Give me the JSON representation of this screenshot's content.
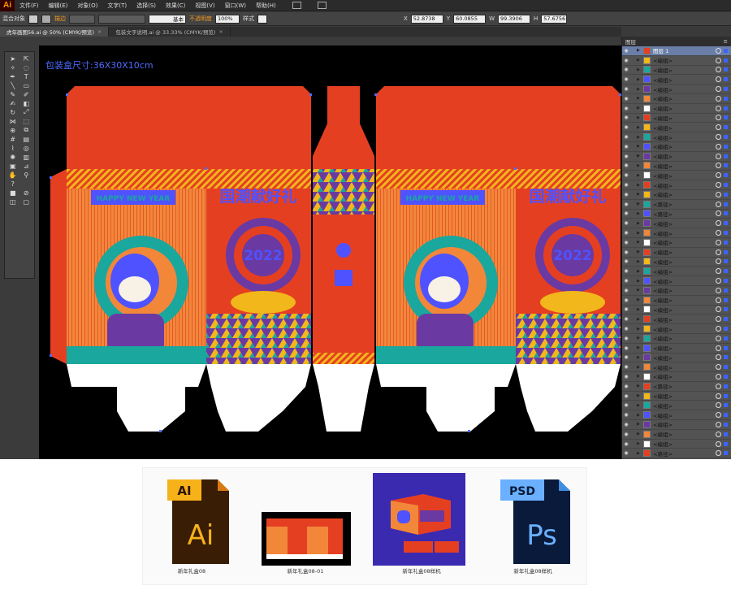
{
  "menubar": {
    "logo": "Ai",
    "items": [
      "文件(F)",
      "编辑(E)",
      "对象(O)",
      "文字(T)",
      "选择(S)",
      "效果(C)",
      "视图(V)",
      "窗口(W)",
      "帮助(H)"
    ]
  },
  "control_bar": {
    "selection_label": "混合对象",
    "stroke_label": "描边",
    "stroke_style": "基本",
    "opacity_label": "不透明度",
    "opacity_value": "100%",
    "style_label": "样式",
    "x_value": "52.8738",
    "y_value": "60.0855",
    "w_value": "99.3906",
    "h_value": "57.6756"
  },
  "tabs": [
    {
      "label": "虎年画图56.ai @ 50% (CMYK/预览)",
      "close": "×"
    },
    {
      "label": "包装文字说明.ai @ 33.33% (CMYK/预览)",
      "close": "×"
    }
  ],
  "artboard": {
    "note": "包装盒尺寸:36X30X10cm",
    "banner": "HAPPY NEW YEAR",
    "headline": "国潮献好礼",
    "year": "2022",
    "colors": {
      "red": "#e53f22",
      "blue": "#4f52ff",
      "teal": "#1aa79d",
      "yellow": "#f2b71b",
      "purple": "#6a3aa2",
      "orange": "#f2873a"
    }
  },
  "layers_panel": {
    "title": "图层",
    "rows": [
      {
        "name": "图层 1",
        "kind": "layer"
      },
      {
        "name": "<编组>"
      },
      {
        "name": "<编组>"
      },
      {
        "name": "<编组>"
      },
      {
        "name": "<编组>"
      },
      {
        "name": "<编组>"
      },
      {
        "name": "<编组>"
      },
      {
        "name": "<编组>"
      },
      {
        "name": "<编组>"
      },
      {
        "name": "<编组>"
      },
      {
        "name": "<编组>"
      },
      {
        "name": "<编组>"
      },
      {
        "name": "<编组>"
      },
      {
        "name": "<编组>"
      },
      {
        "name": "<编组>"
      },
      {
        "name": "<编组>"
      },
      {
        "name": "<路径>"
      },
      {
        "name": "<路径>"
      },
      {
        "name": "<编组>"
      },
      {
        "name": "<编组>"
      },
      {
        "name": "<编组>"
      },
      {
        "name": "<编组>"
      },
      {
        "name": "<编组>"
      },
      {
        "name": "<编组>"
      },
      {
        "name": "<编组>"
      },
      {
        "name": "<编组>"
      },
      {
        "name": "<编组>"
      },
      {
        "name": "<编组>"
      },
      {
        "name": "<编组>"
      },
      {
        "name": "<编组>"
      },
      {
        "name": "<编组>"
      },
      {
        "name": "<编组>"
      },
      {
        "name": "<编组>"
      },
      {
        "name": "<编组>"
      },
      {
        "name": "<编组>"
      },
      {
        "name": "<路径>"
      },
      {
        "name": "<编组>"
      },
      {
        "name": "<编组>"
      },
      {
        "name": "<编组>"
      },
      {
        "name": "<编组>"
      },
      {
        "name": "<编组>"
      },
      {
        "name": "<编组>"
      },
      {
        "name": "<路径>"
      }
    ]
  },
  "files": [
    {
      "caption": "新年礼盒08",
      "type": "AI"
    },
    {
      "caption": "新年礼盒08-01",
      "type": "preview"
    },
    {
      "caption": "新年礼盒08样机",
      "type": "mockup"
    },
    {
      "caption": "新年礼盒08样机",
      "type": "PSD"
    }
  ],
  "file_icons": {
    "ai_tag": "AI",
    "ai_glyph": "Ai",
    "psd_tag": "PSD",
    "psd_glyph": "Ps"
  }
}
